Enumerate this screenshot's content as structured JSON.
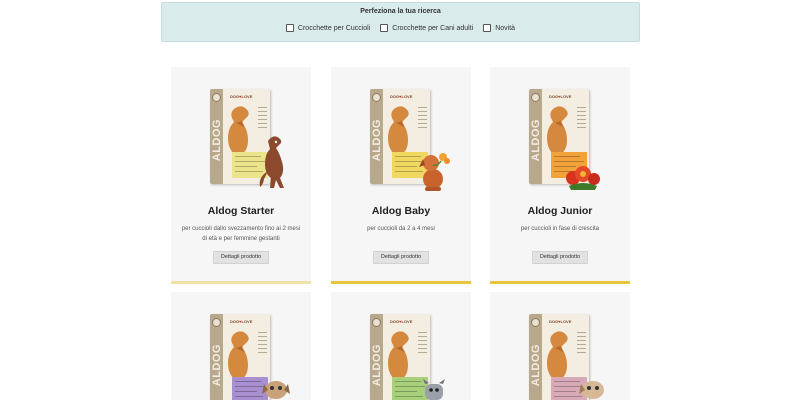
{
  "filters": {
    "title": "Perfeziona la tua ricerca",
    "options": [
      {
        "label": "Crocchette per Cuccioli",
        "checked": false
      },
      {
        "label": "Crocchette per Cani adulti",
        "checked": false
      },
      {
        "label": "Novità",
        "checked": false
      }
    ]
  },
  "pack": {
    "brand": "ALDOG",
    "logo_text": "DOG",
    "logo_text_end": "LOVE"
  },
  "products": [
    {
      "title": "Aldog Starter",
      "description": "per cuccioli dallo svezzamento fino ai 2 mesi di età e per femmine gestanti",
      "button": "Dettagli prodotto",
      "label_color": "#ece48a",
      "icon": "dog-greyhound-icon"
    },
    {
      "title": "Aldog Baby",
      "description": "per cuccioli da 2 a 4 mesi",
      "button": "Dettagli prodotto",
      "label_color": "#f0d760",
      "icon": "puppy-with-flower-icon"
    },
    {
      "title": "Aldog Junior",
      "description": "per cuccioli in fase di crescita",
      "button": "Dettagli prodotto",
      "label_color": "#f1a23a",
      "icon": "flowers-icon"
    }
  ],
  "products_row2": [
    {
      "label_color": "#a88fd0",
      "icon": "small-dog-icon"
    },
    {
      "label_color": "#a8cf7a",
      "icon": "schnauzer-icon"
    },
    {
      "label_color": "#d8a9b7",
      "icon": "small-dog-icon"
    }
  ],
  "colors": {
    "filter_bg": "#d9ebea",
    "card_bg": "#f6f6f6",
    "accent_bar": "#e8c63a",
    "pack_spine": "#b9a98c"
  }
}
